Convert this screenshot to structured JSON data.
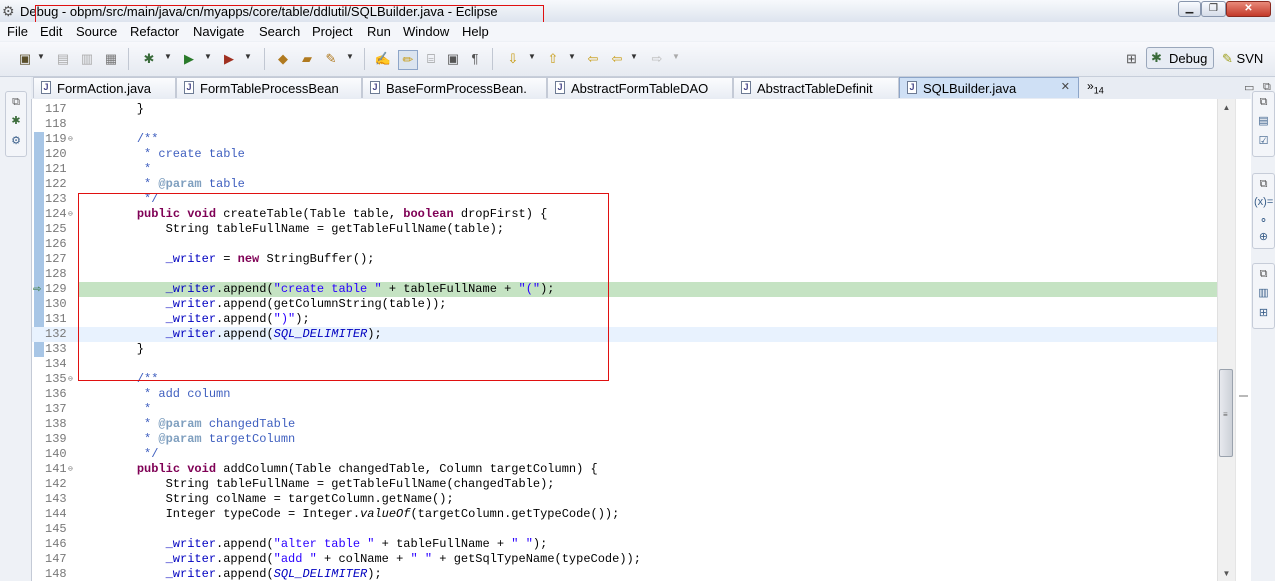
{
  "window": {
    "title": "Debug - obpm/src/main/java/cn/myapps/core/table/ddlutil/SQLBuilder.java - Eclipse",
    "app_icon": "eclipse-icon",
    "controls": {
      "minimize": "▁",
      "maximize": "❐",
      "close": "✕"
    }
  },
  "menu": [
    "File",
    "Edit",
    "Source",
    "Refactor",
    "Navigate",
    "Search",
    "Project",
    "Run",
    "Window",
    "Help"
  ],
  "toolbar": {
    "icons": [
      "new-icon",
      "save-icon",
      "save-all-icon",
      "print-icon",
      "debug-icon",
      "run-icon",
      "external-tools-icon",
      "new-java-package-icon",
      "open-type-icon",
      "search-icon",
      "toggle-mark-occurrences-icon",
      "toggle-highlight-icon",
      "block-selection-icon",
      "show-source-icon",
      "show-whitespace-icon",
      "next-annotation-icon",
      "prev-annotation-icon",
      "last-edit-icon",
      "back-icon",
      "forward-icon"
    ]
  },
  "perspectives": {
    "debug": "Debug",
    "svn": "SVN"
  },
  "tabs": {
    "items": [
      {
        "label": "FormAction.java"
      },
      {
        "label": "FormTableProcessBean"
      },
      {
        "label": "BaseFormProcessBean."
      },
      {
        "label": "AbstractFormTableDAO"
      },
      {
        "label": "AbstractTableDefinit"
      },
      {
        "label": "SQLBuilder.java",
        "active": true
      }
    ],
    "close": "✕",
    "overflow_glyph": "»",
    "overflow_count": "14"
  },
  "editor": {
    "lines": [
      {
        "n": "117",
        "html": "    }"
      },
      {
        "n": "118",
        "html": ""
      },
      {
        "n": "119",
        "fold": true,
        "html": "    <span class='cm'>/**</span>"
      },
      {
        "n": "120",
        "html": "<span class='cm'>     * create table</span>"
      },
      {
        "n": "121",
        "html": "<span class='cm'>     *</span>"
      },
      {
        "n": "122",
        "html": "<span class='cm'>     * </span><span class='tag'>@param</span><span class='cm'> table</span>"
      },
      {
        "n": "123",
        "html": "<span class='cm'>     */</span>"
      },
      {
        "n": "124",
        "fold": true,
        "html": "    <span class='kw'>public</span> <span class='kw'>void</span> createTable(Table table, <span class='kw'>boolean</span> dropFirst) {"
      },
      {
        "n": "125",
        "html": "        String tableFullName = getTableFullName(table);"
      },
      {
        "n": "126",
        "html": ""
      },
      {
        "n": "127",
        "html": "        <span class='fld'>_writer</span> = <span class='kw'>new</span> StringBuffer();"
      },
      {
        "n": "128",
        "html": ""
      },
      {
        "n": "129",
        "debug": true,
        "html": "        <span class='fld'>_writer</span>.append(<span class='str'>\"create table \"</span> + tableFullName + <span class='str'>\"(\"</span>);"
      },
      {
        "n": "130",
        "html": "        <span class='fld'>_writer</span>.append(getColumnString(table));"
      },
      {
        "n": "131",
        "html": "        <span class='fld'>_writer</span>.append(<span class='str'>\")\"</span>);"
      },
      {
        "n": "132",
        "current": true,
        "html": "        <span class='fld'>_writer</span>.append(<span class='sfld'>SQL_DELIMITER</span>);"
      },
      {
        "n": "133",
        "html": "    }"
      },
      {
        "n": "134",
        "html": ""
      },
      {
        "n": "135",
        "fold": true,
        "html": "    <span class='cm'>/**</span>"
      },
      {
        "n": "136",
        "html": "<span class='cm'>     * add column</span>"
      },
      {
        "n": "137",
        "html": "<span class='cm'>     *</span>"
      },
      {
        "n": "138",
        "html": "<span class='cm'>     * </span><span class='tag'>@param</span><span class='cm'> changedTable</span>"
      },
      {
        "n": "139",
        "html": "<span class='cm'>     * </span><span class='tag'>@param</span><span class='cm'> targetColumn</span>"
      },
      {
        "n": "140",
        "html": "<span class='cm'>     */</span>"
      },
      {
        "n": "141",
        "fold": true,
        "html": "    <span class='kw'>public</span> <span class='kw'>void</span> addColumn(Table changedTable, Column targetColumn) {"
      },
      {
        "n": "142",
        "html": "        String tableFullName = getTableFullName(changedTable);"
      },
      {
        "n": "143",
        "html": "        String colName = targetColumn.getName();"
      },
      {
        "n": "144",
        "html": "        Integer typeCode = Integer.<span class='stm'>valueOf</span>(targetColumn.getTypeCode());"
      },
      {
        "n": "145",
        "html": ""
      },
      {
        "n": "146",
        "html": "        <span class='fld'>_writer</span>.append(<span class='str'>\"alter table \"</span> + tableFullName + <span class='str'>\" \"</span>);"
      },
      {
        "n": "147",
        "html": "        <span class='fld'>_writer</span>.append(<span class='str'>\"add \"</span> + colName + <span class='str'>\" \"</span> + getSqlTypeName(typeCode));"
      },
      {
        "n": "148",
        "html": "        <span class='fld'>_writer</span>.append(<span class='sfld'>SQL_DELIMITER</span>);"
      }
    ]
  },
  "colors": {
    "keyword": "#7f0055",
    "comment": "#3f5fbf",
    "string": "#2a00ff",
    "field": "#0000c0",
    "debug_line": "#c5e3c3",
    "annotation_box": "#e01010"
  }
}
